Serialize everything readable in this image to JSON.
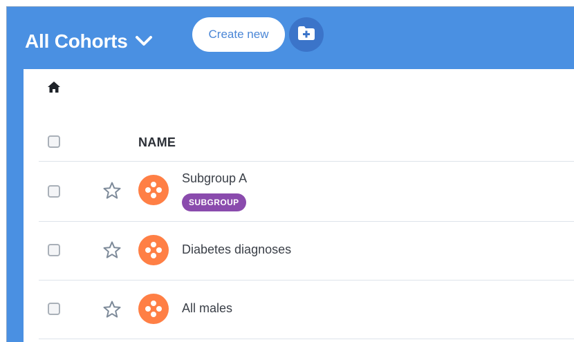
{
  "header": {
    "title": "All Cohorts",
    "create_label": "Create new",
    "icons": {
      "title_dropdown": "chevron-down-icon",
      "new_folder": "folder-plus-icon"
    }
  },
  "breadcrumb": {
    "icon": "home-icon"
  },
  "table": {
    "columns": [
      "NAME"
    ],
    "rows": [
      {
        "name": "Subgroup A",
        "badge": "SUBGROUP",
        "starred": false
      },
      {
        "name": "Diabetes diagnoses",
        "starred": false
      },
      {
        "name": "All males",
        "starred": false
      }
    ]
  },
  "colors": {
    "header_bg": "#4a90e2",
    "cohort_icon": "#ff7f45",
    "badge_bg": "#8a4bad"
  }
}
